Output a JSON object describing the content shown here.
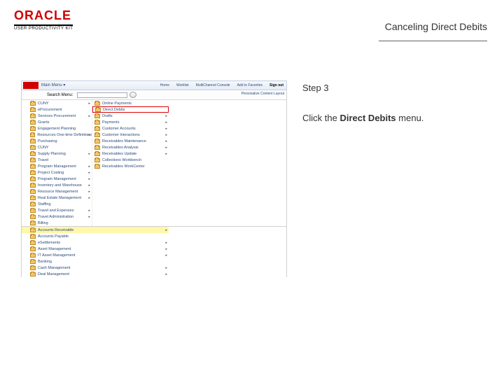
{
  "header": {
    "logo_text": "ORACLE",
    "logo_sub": "USER PRODUCTIVITY KIT",
    "page_title": "Canceling Direct Debits"
  },
  "instructions": {
    "step_label": "Step 3",
    "desc_pre": "Click the ",
    "desc_bold": "Direct Debits",
    "desc_post": " menu."
  },
  "app": {
    "main_menu": "Main Menu",
    "toolbar_items": [
      "Home",
      "Worklist",
      "MultiChannel Console",
      "Add to Favorites",
      "Sign out"
    ],
    "search_label": "Search Menu:",
    "pcenter": "Personalize Content  Layout"
  },
  "col1_items": [
    {
      "label": "CUNY",
      "arrow": true
    },
    {
      "label": "eProcurement",
      "arrow": false
    },
    {
      "label": "Services Procurement",
      "arrow": true
    },
    {
      "label": "Grants",
      "arrow": false
    },
    {
      "label": "Engagement Planning",
      "arrow": false
    },
    {
      "label": "Resources One-time Definitions",
      "arrow": true
    },
    {
      "label": "Purchasing",
      "arrow": false
    },
    {
      "label": "CUNY",
      "arrow": false
    },
    {
      "label": "Supply Planning",
      "arrow": true
    },
    {
      "label": "Travel",
      "arrow": false
    },
    {
      "label": "Program Management",
      "arrow": true
    },
    {
      "label": "Project Costing",
      "arrow": true
    },
    {
      "label": "Program Management",
      "arrow": true
    },
    {
      "label": "Inventory and Warehouse",
      "arrow": true
    },
    {
      "label": "Resource Management",
      "arrow": true
    },
    {
      "label": "Real Estate Management",
      "arrow": true
    },
    {
      "label": "Staffing",
      "arrow": false
    },
    {
      "label": "Travel and Expenses",
      "arrow": true
    },
    {
      "label": "Travel Administration",
      "arrow": true
    },
    {
      "label": "Billing",
      "arrow": false
    }
  ],
  "ar_section_items": [
    {
      "label": "Accounts Receivable",
      "arrow": true,
      "hl": "yellow"
    },
    {
      "label": "Accounts Payable",
      "arrow": false
    },
    {
      "label": "eSettlements",
      "arrow": true
    },
    {
      "label": "Asset Management",
      "arrow": true
    },
    {
      "label": "IT Asset Management",
      "arrow": true
    },
    {
      "label": "Banking",
      "arrow": false
    },
    {
      "label": "Cash Management",
      "arrow": true
    },
    {
      "label": "Deal Management",
      "arrow": true
    }
  ],
  "col2_top": [
    {
      "label": "Online Payments"
    },
    {
      "label": "Direct Debits",
      "hl": "red"
    }
  ],
  "col2_rest": [
    {
      "label": "Drafts",
      "arrow": true
    },
    {
      "label": "Payments",
      "arrow": true
    },
    {
      "label": "Customer Accounts",
      "arrow": true
    },
    {
      "label": "Customer Interactions",
      "arrow": true
    },
    {
      "label": "Receivables Maintenance",
      "arrow": true
    },
    {
      "label": "Receivables Analysis",
      "arrow": true
    },
    {
      "label": "Receivables Update",
      "arrow": true
    },
    {
      "label": "Collections Workbench",
      "arrow": false
    },
    {
      "label": "Receivables WorkCenter",
      "arrow": false
    }
  ]
}
